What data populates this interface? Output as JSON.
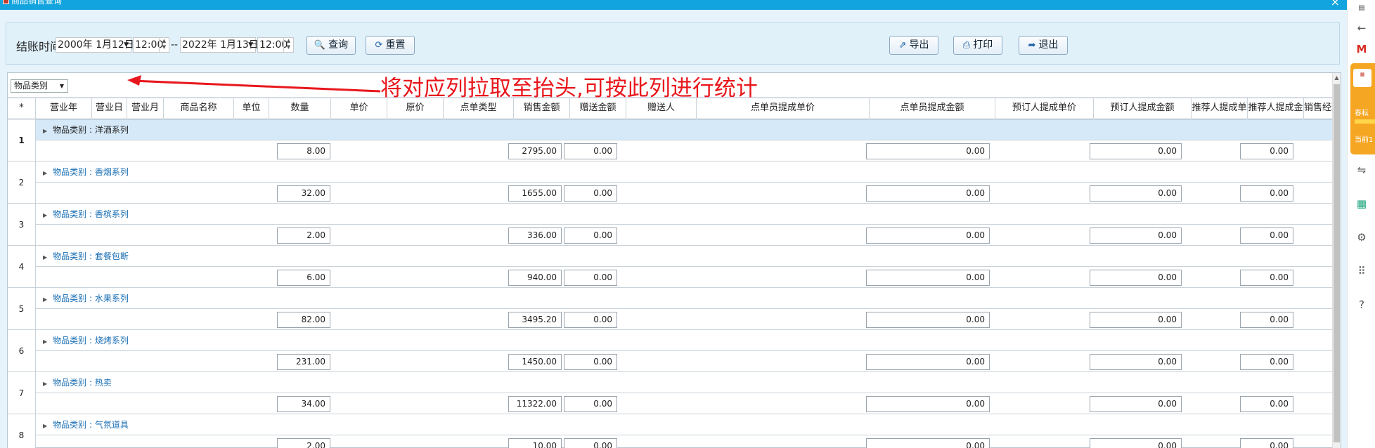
{
  "window": {
    "title": "商品销售查询",
    "close_glyph": "×"
  },
  "toolbar": {
    "label": "结账时间:",
    "start_date": "2000年 1月12日",
    "start_time": "12:00",
    "separator": "--",
    "end_date": "2022年 1月13日",
    "end_time": "12:00",
    "query": "查询",
    "reset": "重置",
    "export": "导出",
    "print": "打印",
    "exit": "退出"
  },
  "group_panel": {
    "chip": "物品类别",
    "annotation": "将对应列拉取至抬头,可按此列进行统计",
    "annotation_color": "#e8171d"
  },
  "columns": [
    "*",
    "营业年",
    "营业日",
    "营业月",
    "商品名称",
    "单位",
    "数量",
    "单价",
    "原价",
    "点单类型",
    "销售金额",
    "赠送金额",
    "赠送人",
    "点单员提成单价",
    "点单员提成金额",
    "预订人提成单价",
    "预订人提成金额",
    "推荐人提成单",
    "推荐人提成金",
    "销售经理"
  ],
  "groups": [
    {
      "row": "1",
      "label": "物品类别 : 洋酒系列",
      "qty": "8.00",
      "sales": "2795.00",
      "gift": "0.00",
      "clerk_amt": "0.00",
      "booker_amt": "0.00",
      "ref_amt": "0.00"
    },
    {
      "row": "2",
      "label": "物品类别 : 香烟系列",
      "qty": "32.00",
      "sales": "1655.00",
      "gift": "0.00",
      "clerk_amt": "0.00",
      "booker_amt": "0.00",
      "ref_amt": "0.00"
    },
    {
      "row": "3",
      "label": "物品类别 : 香槟系列",
      "qty": "2.00",
      "sales": "336.00",
      "gift": "0.00",
      "clerk_amt": "0.00",
      "booker_amt": "0.00",
      "ref_amt": "0.00"
    },
    {
      "row": "4",
      "label": "物品类别 : 套餐包断",
      "qty": "6.00",
      "sales": "940.00",
      "gift": "0.00",
      "clerk_amt": "0.00",
      "booker_amt": "0.00",
      "ref_amt": "0.00"
    },
    {
      "row": "5",
      "label": "物品类别 : 水果系列",
      "qty": "82.00",
      "sales": "3495.20",
      "gift": "0.00",
      "clerk_amt": "0.00",
      "booker_amt": "0.00",
      "ref_amt": "0.00"
    },
    {
      "row": "6",
      "label": "物品类别 : 烧烤系列",
      "qty": "231.00",
      "sales": "1450.00",
      "gift": "0.00",
      "clerk_amt": "0.00",
      "booker_amt": "0.00",
      "ref_amt": "0.00"
    },
    {
      "row": "7",
      "label": "物品类别 : 热卖",
      "qty": "34.00",
      "sales": "11322.00",
      "gift": "0.00",
      "clerk_amt": "0.00",
      "booker_amt": "0.00",
      "ref_amt": "0.00"
    },
    {
      "row": "8",
      "label": "物品类别 : 气氛道具",
      "qty": "2.00",
      "sales": "10.00",
      "gift": "0.00",
      "clerk_amt": "0.00",
      "booker_amt": "0.00",
      "ref_amt": "0.00"
    }
  ],
  "side_icons": [
    "back-icon",
    "gmail-icon",
    "translate-icon",
    "grid-icon",
    "settings-icon",
    "apps-icon",
    "help-icon"
  ],
  "promo": {
    "line1": "春耘",
    "line2": "当前1"
  }
}
